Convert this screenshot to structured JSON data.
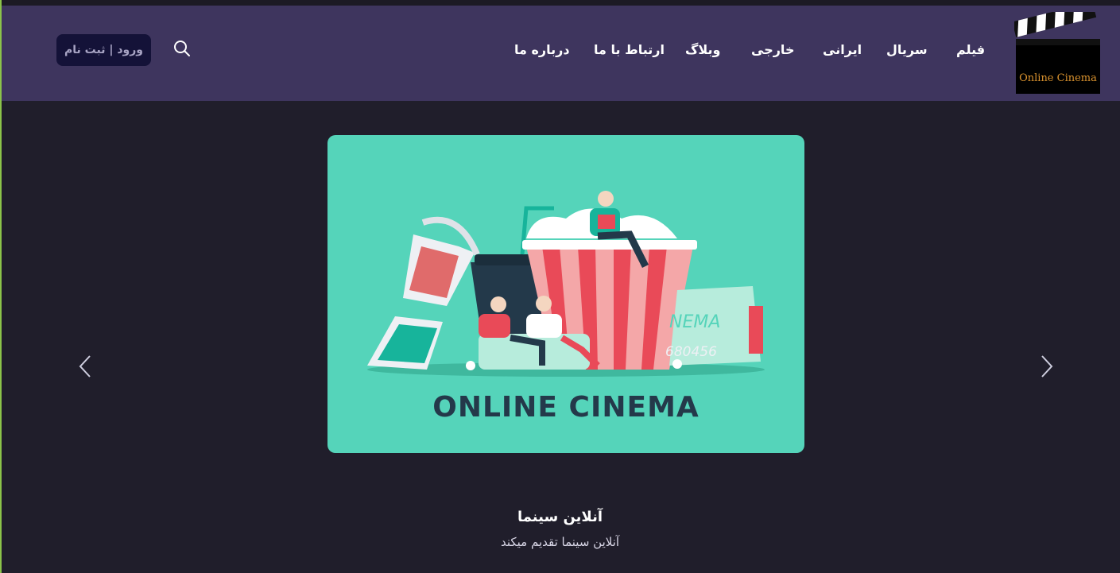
{
  "header": {
    "logo_text": "Online Cinema",
    "nav": [
      {
        "label": "فیلم"
      },
      {
        "label": "سریال"
      },
      {
        "label": "ایرانی"
      },
      {
        "label": "خارجی"
      },
      {
        "label": "وبلاگ"
      },
      {
        "label": "ارتباط با ما"
      },
      {
        "label": "درباره ما"
      }
    ],
    "auth_label": "ورود | ثبت نام",
    "search_icon": "search-icon"
  },
  "slider": {
    "banner_title": "ONLINE CINEMA",
    "ticket_text": "NEMA",
    "ticket_number": "680456",
    "prev_icon": "chevron-left-icon",
    "next_icon": "chevron-right-icon"
  },
  "caption": {
    "title": "آنلاین سینما",
    "subtitle": "آنلاین سینما تقدیم میکند"
  },
  "colors": {
    "header_bg": "#3e355e",
    "page_bg": "#201e2b",
    "banner_bg": "#55d4ba",
    "button_bg": "#141238"
  }
}
